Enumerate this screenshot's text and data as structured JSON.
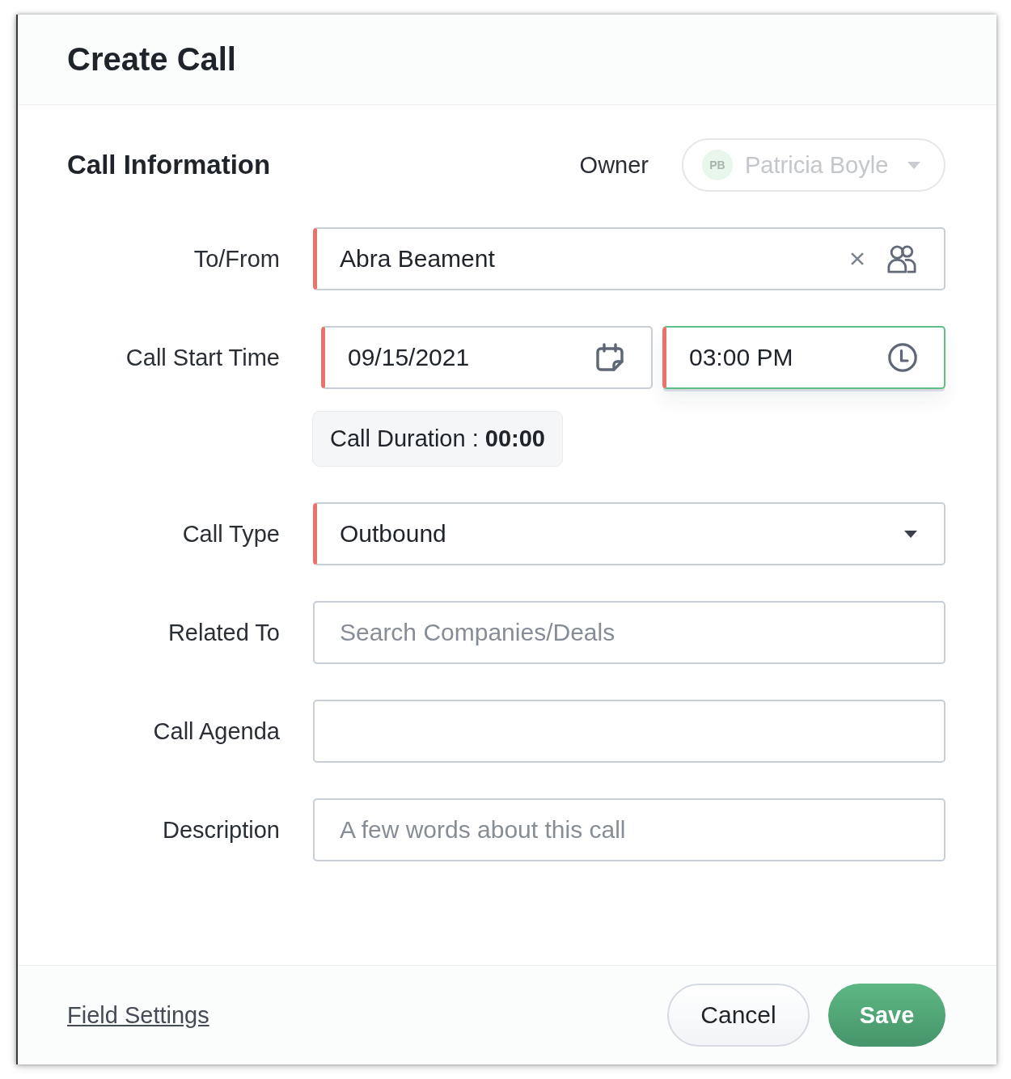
{
  "dialog": {
    "title": "Create Call"
  },
  "section": {
    "title": "Call Information",
    "owner": {
      "label": "Owner",
      "initials": "PB",
      "name": "Patricia Boyle",
      "disabled": true
    }
  },
  "fields": [
    {
      "kind": "lookup",
      "label": "To/From",
      "value": "Abra Beament",
      "required": true
    },
    {
      "kind": "datetime",
      "label": "Call Start Time",
      "required": true,
      "date": {
        "value": "09/15/2021",
        "focused": false
      },
      "time": {
        "value": "03:00 PM",
        "focused": true
      },
      "duration": "Call Duration : **00:00**"
    },
    {
      "kind": "select",
      "label": "Call Type",
      "value": "Outbound",
      "required": true
    },
    {
      "kind": "text",
      "label": "Related To",
      "placeholder": "Search Companies/Deals",
      "required": false
    },
    {
      "kind": "text",
      "label": "Call Agenda",
      "required": false
    },
    {
      "kind": "text",
      "label": "Description",
      "placeholder": "A few words about this call",
      "required": false
    }
  ],
  "footer": {
    "link": "Field Settings",
    "buttons": [
      {
        "kind": "secondary",
        "label": "Cancel"
      },
      {
        "kind": "primary",
        "label": "Save"
      }
    ]
  }
}
